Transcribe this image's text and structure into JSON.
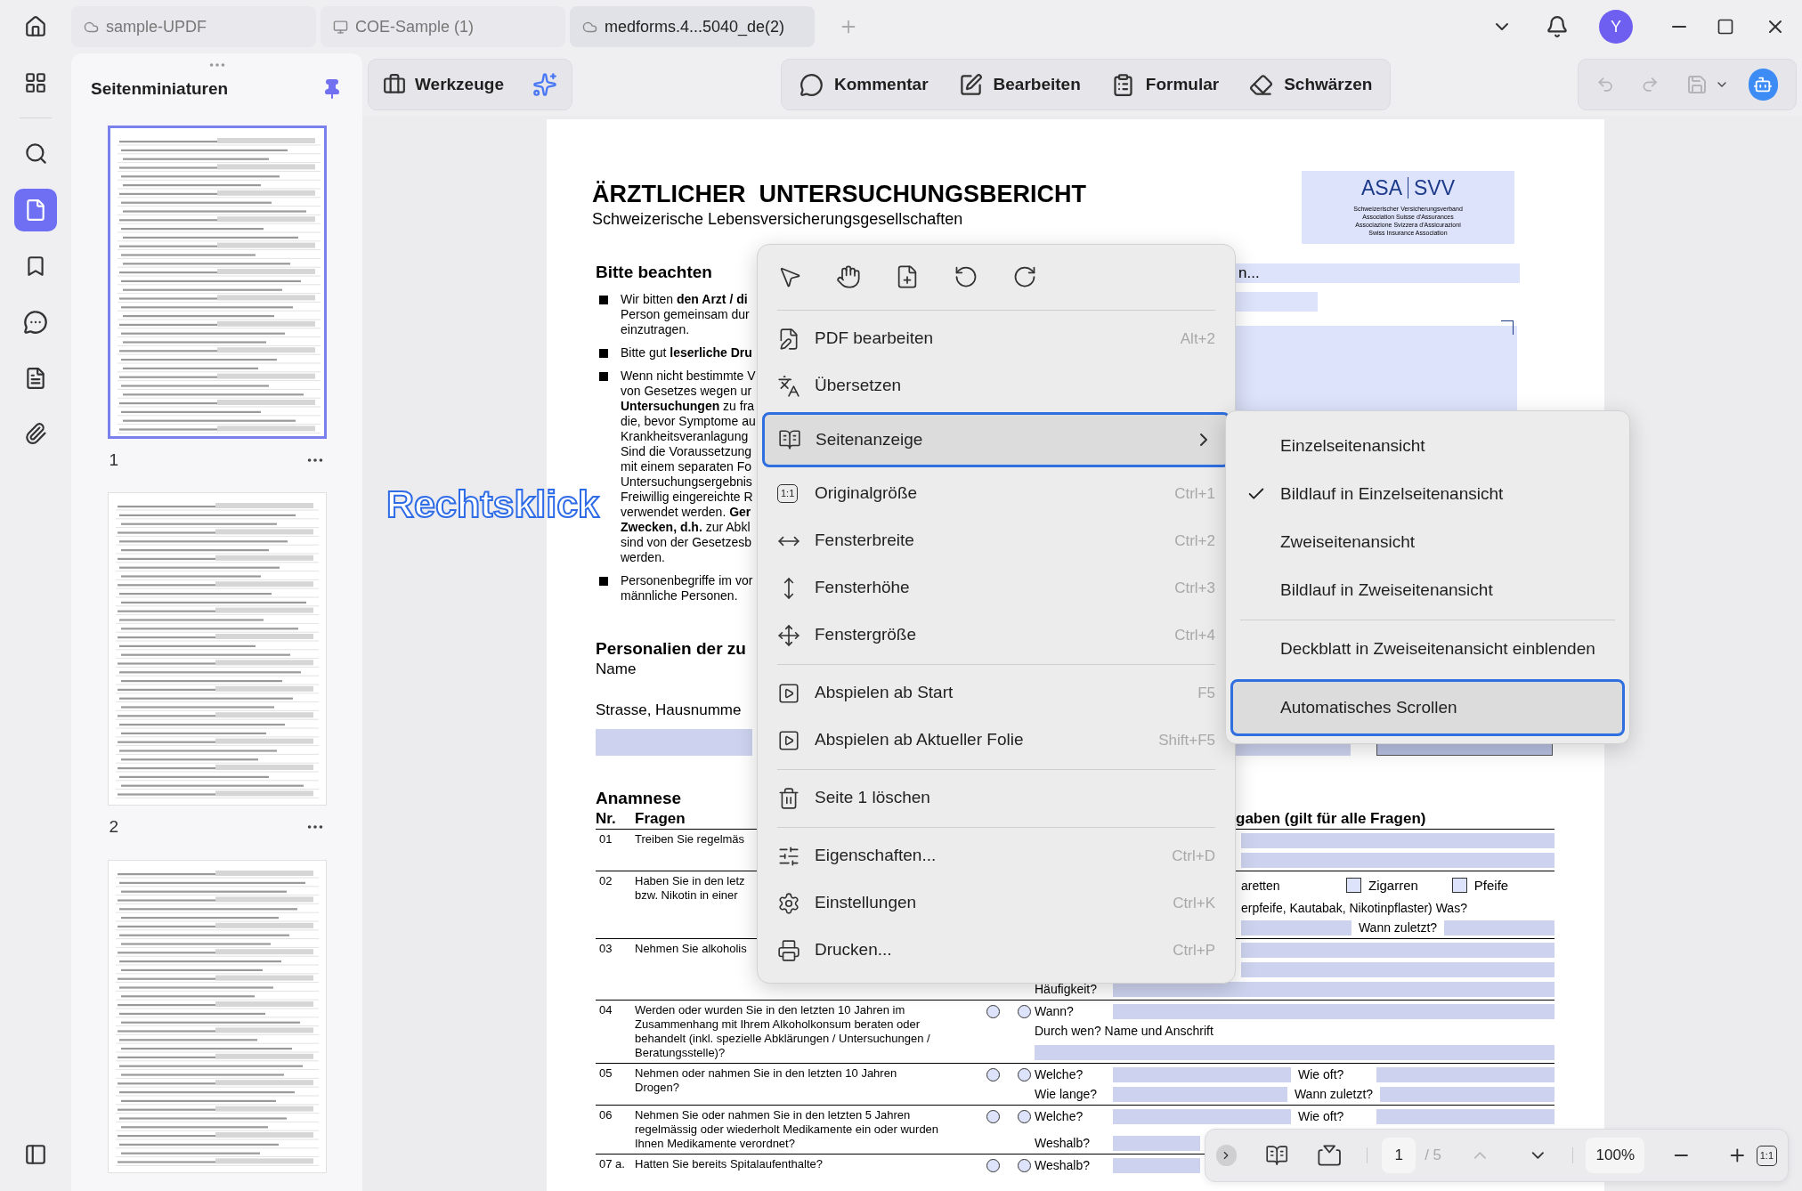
{
  "tabs": [
    {
      "label": "sample-UPDF",
      "selected": false
    },
    {
      "label": "COE-Sample (1)",
      "selected": false
    },
    {
      "label": "medforms.4...5040_de(2)",
      "selected": true
    }
  ],
  "account": {
    "initial": "Y"
  },
  "sidebar": {
    "title": "Seitenminiaturen",
    "thumbnails": [
      {
        "page": "1",
        "selected": true
      },
      {
        "page": "2",
        "selected": false
      },
      {
        "selected": false
      }
    ]
  },
  "toolbar": {
    "tools_label": "Werkzeuge",
    "modes": [
      {
        "label": "Kommentar"
      },
      {
        "label": "Bearbeiten"
      },
      {
        "label": "Formular"
      },
      {
        "label": "Schwärzen"
      }
    ]
  },
  "document": {
    "title": "ÄRZTLICHER  UNTERSUCHUNGSBERICHT",
    "subtitle": "Schweizerische Lebensversicherungsgesellschaften",
    "logo": {
      "left": "ASA",
      "right": "SVV",
      "lines": [
        "Schweizerischer Versicherungsverband",
        "Association Suisse d'Assurances",
        "Associazione Svizzera d'Assicurazioni",
        "Swiss Insurance Association"
      ]
    },
    "notes_title": "Bitte beachten",
    "notes": [
      [
        "Wir bitten **den Arzt / di**",
        "Person gemeinsam dur",
        "einzutragen."
      ],
      [
        "Bitte gut **leserliche Dru**"
      ],
      [
        "Wenn nicht bestimmte V",
        "von Gesetzes wegen ur",
        "**Untersuchungen** zu fra",
        "die, bevor Symptome au",
        "Krankheitsveranlagung",
        "Sind die Voraussetzung",
        "mit einem separaten Fo",
        "Untersuchungsergebnis",
        "Freiwillig eingereichte R",
        "verwendet werden. **Ger**",
        "**Zwecken, d.h.** zur Abkl",
        "sind von der Gesetzesb",
        "werden."
      ],
      [
        "Personenbegriffe im vor",
        "männliche Personen."
      ]
    ],
    "top_field_value": "n...",
    "personal_title": "Personalien der zu",
    "name_label": "Name",
    "street_label": "Strasse, Hausnumme",
    "anamnese": {
      "title": "Anamnese",
      "headers": [
        "Nr.",
        "Fragen",
        "gaben (gilt für alle Fragen)"
      ],
      "rows": [
        {
          "nr": "01",
          "question": [
            "Treiben Sie regelmäs"
          ],
          "lines": [
            {
              "clipped": true,
              "parts": [
                {
                  "kind": "field"
                }
              ]
            },
            {
              "clipped": true,
              "parts": [
                {
                  "kind": "field"
                }
              ]
            }
          ]
        },
        {
          "nr": "02",
          "question": [
            "Haben Sie in den letz",
            "bzw. Nikotin in einer"
          ],
          "lines": [
            {
              "clipped": true,
              "parts": [
                {
                  "kind": "text",
                  "text": "aretten"
                },
                {
                  "kind": "checkbox",
                  "checked": false,
                  "text": "Zigarren"
                },
                {
                  "kind": "checkbox",
                  "checked": false,
                  "text": "Pfeife"
                }
              ]
            },
            {
              "clipped": true,
              "parts": [
                {
                  "kind": "text",
                  "text": "erpfeife, Kautabak, Nikotinpflaster) Was?"
                }
              ]
            },
            {
              "clipped": true,
              "parts": [
                {
                  "kind": "field"
                },
                {
                  "kind": "text",
                  "text": "Wann zuletzt?"
                },
                {
                  "kind": "field"
                }
              ]
            }
          ]
        },
        {
          "nr": "03",
          "question": [
            "Nehmen Sie alkoholis"
          ],
          "lines": [
            {
              "clipped": true,
              "parts": [
                {
                  "kind": "field"
                }
              ]
            },
            {
              "clipped": true,
              "parts": [
                {
                  "kind": "field"
                }
              ]
            },
            {
              "clipped": false,
              "parts": [
                {
                  "kind": "text",
                  "text": "Häufigkeit?"
                },
                {
                  "kind": "field"
                }
              ]
            }
          ]
        },
        {
          "nr": "04",
          "question": [
            "Werden oder wurden Sie in den letzten 10 Jahren im",
            "Zusammenhang mit Ihrem Alkoholkonsum beraten oder",
            "behandelt (inkl. spezielle Abklärungen / Untersuchungen /",
            "Beratungsstelle)?"
          ],
          "radios": [
            {
              "selected": false
            },
            {
              "selected": false
            }
          ],
          "lines": [
            {
              "clipped": false,
              "parts": [
                {
                  "kind": "text",
                  "text": "Wann?"
                },
                {
                  "kind": "field"
                }
              ]
            },
            {
              "clipped": false,
              "parts": [
                {
                  "kind": "text",
                  "text": "Durch wen? Name und Anschrift"
                }
              ]
            },
            {
              "clipped": false,
              "parts": [
                {
                  "kind": "field"
                }
              ]
            }
          ]
        },
        {
          "nr": "05",
          "question": [
            "Nehmen oder nahmen Sie in den letzten 10 Jahren",
            "Drogen?"
          ],
          "radios": [
            {
              "selected": false
            },
            {
              "selected": false
            }
          ],
          "lines": [
            {
              "clipped": false,
              "parts": [
                {
                  "kind": "text",
                  "text": "Welche?"
                },
                {
                  "kind": "field"
                },
                {
                  "kind": "text",
                  "text": "Wie oft?"
                },
                {
                  "kind": "field"
                }
              ]
            },
            {
              "clipped": false,
              "parts": [
                {
                  "kind": "text",
                  "text": "Wie lange?"
                },
                {
                  "kind": "field"
                },
                {
                  "kind": "text",
                  "text": "Wann zuletzt?"
                },
                {
                  "kind": "field"
                }
              ]
            }
          ]
        },
        {
          "nr": "06",
          "question": [
            "Nehmen Sie oder nahmen Sie in den letzten 5 Jahren",
            "regelmässig oder wiederholt Medikamente ein oder wurden",
            "Ihnen Medikamente verordnet?"
          ],
          "radios": [
            {
              "selected": false
            },
            {
              "selected": false
            }
          ],
          "lines": [
            {
              "clipped": false,
              "parts": [
                {
                  "kind": "text",
                  "text": "Welche?"
                },
                {
                  "kind": "field"
                },
                {
                  "kind": "text",
                  "text": "Wie oft?"
                },
                {
                  "kind": "field"
                }
              ]
            },
            {
              "clipped": false,
              "parts": [
                {
                  "kind": "text",
                  "text": "Weshalb?"
                },
                {
                  "kind": "field"
                }
              ]
            }
          ]
        },
        {
          "nr": "07 a.",
          "question": [
            "Hatten Sie bereits Spitalaufenthalte?"
          ],
          "radios": [
            {
              "selected": false
            },
            {
              "selected": false
            }
          ],
          "lines": [
            {
              "clipped": false,
              "parts": [
                {
                  "kind": "text",
                  "text": "Weshalb?"
                },
                {
                  "kind": "field"
                }
              ]
            }
          ]
        }
      ]
    }
  },
  "annotation": "Rechtsklick",
  "context_menu": {
    "items": [
      {
        "kind": "item",
        "label": "PDF bearbeiten",
        "shortcut": "Alt+2",
        "selected": false
      },
      {
        "kind": "item",
        "label": "Übersetzen",
        "selected": false
      },
      {
        "kind": "item",
        "label": "Seitenanzeige",
        "submenu": true,
        "selected": true
      },
      {
        "kind": "item",
        "label": "Originalgröße",
        "shortcut": "Ctrl+1",
        "badge": "1:1",
        "selected": false
      },
      {
        "kind": "item",
        "label": "Fensterbreite",
        "shortcut": "Ctrl+2",
        "selected": false
      },
      {
        "kind": "item",
        "label": "Fensterhöhe",
        "shortcut": "Ctrl+3",
        "selected": false
      },
      {
        "kind": "item",
        "label": "Fenstergröße",
        "shortcut": "Ctrl+4",
        "selected": false
      },
      {
        "kind": "separator"
      },
      {
        "kind": "item",
        "label": "Abspielen ab Start",
        "shortcut": "F5",
        "selected": false
      },
      {
        "kind": "item",
        "label": "Abspielen ab Aktueller Folie",
        "shortcut": "Shift+F5",
        "selected": false
      },
      {
        "kind": "separator"
      },
      {
        "kind": "item",
        "label": "Seite 1 löschen",
        "selected": false
      },
      {
        "kind": "separator"
      },
      {
        "kind": "item",
        "label": "Eigenschaften...",
        "shortcut": "Ctrl+D",
        "selected": false
      },
      {
        "kind": "item",
        "label": "Einstellungen",
        "shortcut": "Ctrl+K",
        "selected": false
      },
      {
        "kind": "item",
        "label": "Drucken...",
        "shortcut": "Ctrl+P",
        "selected": false
      }
    ]
  },
  "submenu": {
    "items": [
      {
        "kind": "item",
        "label": "Einzelseitenansicht",
        "checked": false,
        "selected": false
      },
      {
        "kind": "item",
        "label": "Bildlauf in Einzelseitenansicht",
        "checked": true,
        "selected": false
      },
      {
        "kind": "item",
        "label": "Zweiseitenansicht",
        "checked": false,
        "selected": false
      },
      {
        "kind": "item",
        "label": "Bildlauf in Zweiseitenansicht",
        "checked": false,
        "selected": false
      },
      {
        "kind": "separator"
      },
      {
        "kind": "item",
        "label": "Deckblatt in Zweiseitenansicht einblenden",
        "checked": false,
        "selected": false
      },
      {
        "kind": "item",
        "label": "Automatisches Scrollen",
        "checked": false,
        "selected": true
      }
    ]
  },
  "bottom_bar": {
    "page": "1",
    "total": "/ 5",
    "zoom": "100%",
    "actual_size": "1:1"
  }
}
